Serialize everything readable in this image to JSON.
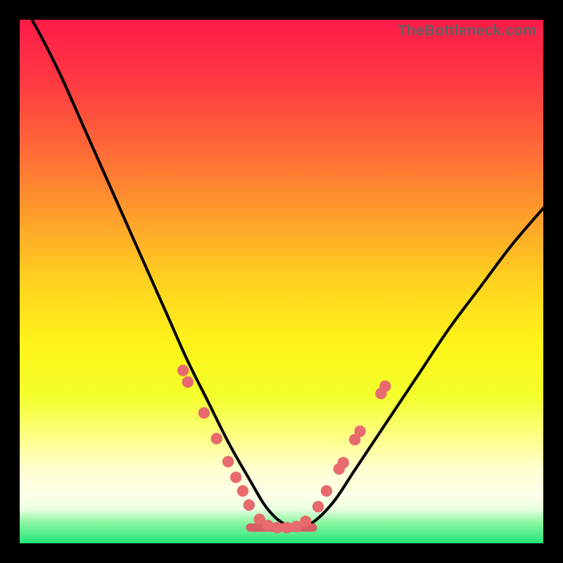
{
  "watermark": "TheBottleneck.com",
  "gradient": {
    "stops": [
      {
        "offset": 0.0,
        "color": "#ff1b49"
      },
      {
        "offset": 0.12,
        "color": "#ff3a42"
      },
      {
        "offset": 0.25,
        "color": "#ff6a37"
      },
      {
        "offset": 0.38,
        "color": "#ffa02a"
      },
      {
        "offset": 0.5,
        "color": "#ffd21f"
      },
      {
        "offset": 0.62,
        "color": "#fff41a"
      },
      {
        "offset": 0.72,
        "color": "#f2ff2b"
      },
      {
        "offset": 0.8,
        "color": "#ffff8a"
      },
      {
        "offset": 0.86,
        "color": "#ffffd2"
      },
      {
        "offset": 0.905,
        "color": "#ffffe8"
      },
      {
        "offset": 0.935,
        "color": "#e9ffe0"
      },
      {
        "offset": 0.96,
        "color": "#8cf7a1"
      },
      {
        "offset": 1.0,
        "color": "#22e57a"
      }
    ]
  },
  "chart_data": {
    "type": "line",
    "title": "",
    "xlabel": "",
    "ylabel": "",
    "xlim": [
      0,
      100
    ],
    "ylim": [
      0,
      100
    ],
    "series": [
      {
        "name": "bottleneck-curve",
        "x": [
          0,
          4,
          8,
          12,
          16,
          20,
          24,
          28,
          32,
          36,
          40,
          44,
          47,
          50,
          53,
          56,
          60,
          64,
          70,
          76,
          82,
          88,
          94,
          100
        ],
        "y": [
          104,
          97,
          89,
          80,
          71,
          62,
          53,
          44,
          35,
          27,
          19,
          12,
          7,
          4,
          3,
          4,
          8,
          14,
          23,
          32,
          41,
          49,
          57,
          64
        ]
      }
    ],
    "flat_segment": {
      "x0": 44,
      "x1": 56,
      "y": 3
    },
    "markers": [
      {
        "x": 31.2,
        "y": 33.0,
        "r": 1.1
      },
      {
        "x": 32.1,
        "y": 30.8,
        "r": 1.1
      },
      {
        "x": 35.2,
        "y": 24.9,
        "r": 1.1
      },
      {
        "x": 37.6,
        "y": 20.0,
        "r": 1.1
      },
      {
        "x": 39.8,
        "y": 15.6,
        "r": 1.1
      },
      {
        "x": 41.3,
        "y": 12.6,
        "r": 1.1
      },
      {
        "x": 42.6,
        "y": 10.0,
        "r": 1.1
      },
      {
        "x": 43.8,
        "y": 7.3,
        "r": 1.1
      },
      {
        "x": 45.8,
        "y": 4.6,
        "r": 1.1
      },
      {
        "x": 47.4,
        "y": 3.4,
        "r": 1.1
      },
      {
        "x": 49.2,
        "y": 3.0,
        "r": 1.1
      },
      {
        "x": 51.0,
        "y": 3.0,
        "r": 1.1
      },
      {
        "x": 52.8,
        "y": 3.2,
        "r": 1.1
      },
      {
        "x": 54.6,
        "y": 4.2,
        "r": 1.1
      },
      {
        "x": 57.0,
        "y": 7.0,
        "r": 1.1
      },
      {
        "x": 58.6,
        "y": 10.0,
        "r": 1.1
      },
      {
        "x": 61.0,
        "y": 14.2,
        "r": 1.1
      },
      {
        "x": 61.8,
        "y": 15.4,
        "r": 1.1
      },
      {
        "x": 64.0,
        "y": 19.8,
        "r": 1.1
      },
      {
        "x": 65.0,
        "y": 21.4,
        "r": 1.1
      },
      {
        "x": 69.0,
        "y": 28.6,
        "r": 1.1
      },
      {
        "x": 69.8,
        "y": 30.0,
        "r": 1.1
      }
    ],
    "marker_color": "#e76a6f",
    "curve_color": "#000000",
    "flat_color": "#d85e64"
  }
}
